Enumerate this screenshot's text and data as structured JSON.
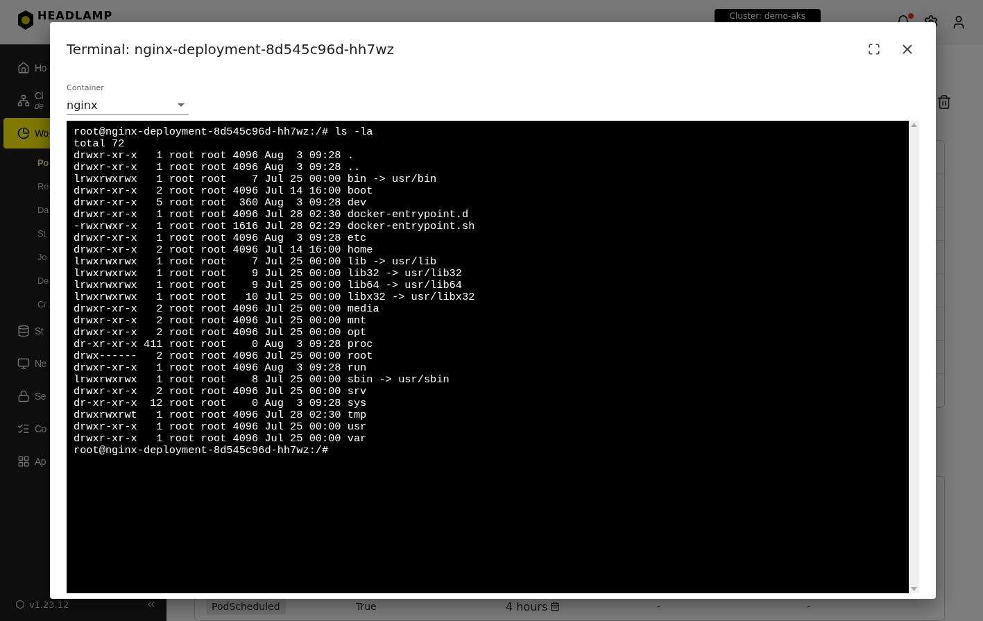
{
  "header": {
    "logo": "HEADLAMP",
    "cluster_button": "Cluster: demo-aks",
    "notifications_unread": true
  },
  "sidebar": {
    "items": [
      {
        "label": "Ho",
        "selected": false
      },
      {
        "label": "Cl",
        "sublabel": "de",
        "selected": false
      },
      {
        "label": "Wo",
        "selected": true,
        "children": [
          {
            "label": "Po",
            "selected": true
          },
          {
            "label": "Re",
            "selected": false
          },
          {
            "label": "Da",
            "selected": false
          },
          {
            "label": "St",
            "selected": false
          },
          {
            "label": "Jo",
            "selected": false
          },
          {
            "label": "De",
            "selected": false
          },
          {
            "label": "Cr",
            "selected": false
          }
        ]
      },
      {
        "label": "St",
        "selected": false
      },
      {
        "label": "Ne",
        "selected": false
      },
      {
        "label": "Se",
        "selected": false
      },
      {
        "label": "Co",
        "selected": false
      },
      {
        "label": "Ap",
        "selected": false
      }
    ],
    "version": "v1.23.12"
  },
  "conditions_row": {
    "type": "PodScheduled",
    "status": "True",
    "age": "4 hours",
    "column_4": "-",
    "column_5": "-"
  },
  "dialog": {
    "title": "Terminal: nginx-deployment-8d545c96d-hh7wz",
    "container_select": {
      "label": "Container",
      "value": "nginx"
    },
    "terminal": {
      "lines": [
        "root@nginx-deployment-8d545c96d-hh7wz:/# ls -la",
        "total 72",
        "drwxr-xr-x   1 root root 4096 Aug  3 09:28 .",
        "drwxr-xr-x   1 root root 4096 Aug  3 09:28 ..",
        "lrwxrwxrwx   1 root root    7 Jul 25 00:00 bin -> usr/bin",
        "drwxr-xr-x   2 root root 4096 Jul 14 16:00 boot",
        "drwxr-xr-x   5 root root  360 Aug  3 09:28 dev",
        "drwxr-xr-x   1 root root 4096 Jul 28 02:30 docker-entrypoint.d",
        "-rwxrwxr-x   1 root root 1616 Jul 28 02:29 docker-entrypoint.sh",
        "drwxr-xr-x   1 root root 4096 Aug  3 09:28 etc",
        "drwxr-xr-x   2 root root 4096 Jul 14 16:00 home",
        "lrwxrwxrwx   1 root root    7 Jul 25 00:00 lib -> usr/lib",
        "lrwxrwxrwx   1 root root    9 Jul 25 00:00 lib32 -> usr/lib32",
        "lrwxrwxrwx   1 root root    9 Jul 25 00:00 lib64 -> usr/lib64",
        "lrwxrwxrwx   1 root root   10 Jul 25 00:00 libx32 -> usr/libx32",
        "drwxr-xr-x   2 root root 4096 Jul 25 00:00 media",
        "drwxr-xr-x   2 root root 4096 Jul 25 00:00 mnt",
        "drwxr-xr-x   2 root root 4096 Jul 25 00:00 opt",
        "dr-xr-xr-x 411 root root    0 Aug  3 09:28 proc",
        "drwx------   2 root root 4096 Jul 25 00:00 root",
        "drwxr-xr-x   1 root root 4096 Aug  3 09:28 run",
        "lrwxrwxrwx   1 root root    8 Jul 25 00:00 sbin -> usr/sbin",
        "drwxr-xr-x   2 root root 4096 Jul 25 00:00 srv",
        "dr-xr-xr-x  12 root root    0 Aug  3 09:28 sys",
        "drwxrwxrwt   1 root root 4096 Jul 28 02:30 tmp",
        "drwxr-xr-x   1 root root 4096 Jul 25 00:00 usr",
        "drwxr-xr-x   1 root root 4096 Jul 25 00:00 var",
        "root@nginx-deployment-8d545c96d-hh7wz:/#"
      ]
    }
  }
}
